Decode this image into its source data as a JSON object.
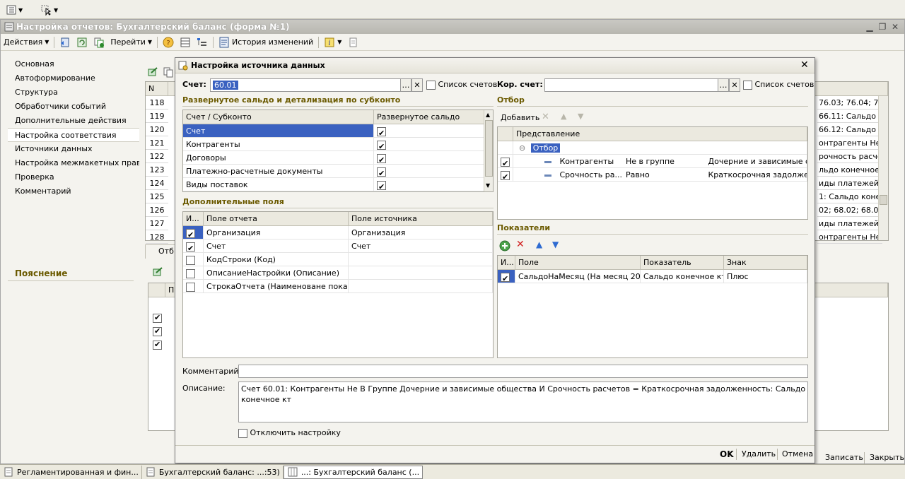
{
  "top_toolbar": {},
  "main_window": {
    "title": "Настройка отчетов: Бухгалтерский баланс (форма №1)",
    "menu": {
      "actions": "Действия",
      "goto": "Перейти",
      "history": "История изменений"
    },
    "nav_items": [
      "Основная",
      "Автоформирование",
      "Структура",
      "Обработчики событий",
      "Дополнительные действия",
      "Настройка соответствия",
      "Источники данных",
      "Настройка межмакетных правил",
      "Проверка",
      "Комментарий"
    ],
    "explanation": "Пояснение",
    "table": {
      "n_header": "N",
      "row_numbers": [
        "118",
        "119",
        "120",
        "121",
        "122",
        "123",
        "124",
        "125",
        "126",
        "127",
        "128"
      ],
      "right_cells": [
        "76.03; 76.04; 76...",
        "66.11: Сальдо к...",
        "66.12: Сальдо к...",
        "онтрагенты Не...",
        "рочность расче...",
        "льдо конечное кт",
        "иды платежей в б...",
        "1: Сальдо конеч...",
        "02; 68.02; 68.03;...",
        "иды платежей ...",
        "онтрагенты Не..."
      ]
    },
    "lower_tab": "Отб",
    "lower_col": "П",
    "buttons": {
      "ok": "OK",
      "save": "Записать",
      "close": "Закрыть"
    }
  },
  "dialog": {
    "title": "Настройка источника данных",
    "account_label": "Счет:",
    "account_value": "60.01",
    "account_list": "Список счетов",
    "corr_label": "Кор. счет:",
    "corr_value": "",
    "corr_list": "Список счетов",
    "expanded_section": "Развернутое сальдо и детализация по субконто",
    "expanded_grid": {
      "headers": [
        "Счет / Субконто",
        "Развернутое сальдо"
      ],
      "rows": [
        {
          "name": "Счет",
          "checked": true
        },
        {
          "name": "Контрагенты",
          "checked": true
        },
        {
          "name": "Договоры",
          "checked": true
        },
        {
          "name": "Платежно-расчетные документы",
          "checked": true
        },
        {
          "name": "Виды поставок",
          "checked": true
        }
      ]
    },
    "extra_section": "Дополнительные поля",
    "extra_grid": {
      "headers": [
        "И...",
        "Поле отчета",
        "Поле источника"
      ],
      "rows": [
        {
          "checked": true,
          "report_field": "Организация",
          "source_field": "Организация"
        },
        {
          "checked": true,
          "report_field": "Счет",
          "source_field": "Счет"
        },
        {
          "checked": false,
          "report_field": "КодСтроки (Код)",
          "source_field": ""
        },
        {
          "checked": false,
          "report_field": "ОписаниеНастройки (Описание)",
          "source_field": ""
        },
        {
          "checked": false,
          "report_field": "СтрокаОтчета (Наименоване показа...",
          "source_field": ""
        }
      ]
    },
    "filter_section": "Отбор",
    "filter_add": "Добавить",
    "filter_grid": {
      "header": "Представление",
      "group": "Отбор",
      "rows": [
        {
          "field": "Контрагенты",
          "condition": "Не в группе",
          "value": "Дочерние и зависимые об..."
        },
        {
          "field": "Срочность ра...",
          "condition": "Равно",
          "value": "Краткосрочная задолжен..."
        }
      ]
    },
    "indicators_section": "Показатели",
    "indicators_grid": {
      "headers": [
        "И...",
        "Поле",
        "Показатель",
        "Знак"
      ],
      "rows": [
        {
          "checked": true,
          "field": "СальдоНаМесяц (На месяц 20x...",
          "indicator": "Сальдо конечное кт",
          "sign": "Плюс"
        }
      ]
    },
    "comment_label": "Комментарий:",
    "comment_value": "",
    "description_label": "Описание:",
    "description_value": "Счет 60.01: Контрагенты Не В Группе Дочерние и зависимые общества И Срочность расчетов = Краткосрочная задолженность: Сальдо конечное кт",
    "disable_label": "Отключить настройку",
    "buttons": {
      "ok": "OK",
      "delete": "Удалить",
      "cancel": "Отмена"
    }
  },
  "taskbar": [
    {
      "label": "Регламентированная и фин...",
      "active": false
    },
    {
      "label": "Бухгалтерский баланс: ...:53)",
      "active": false
    },
    {
      "label": "...: Бухгалтерский баланс (...",
      "active": true
    }
  ],
  "colors": {
    "selection": "#3a61c0",
    "section_title": "#6b5a00",
    "window_bg": "#f4f3ee"
  }
}
